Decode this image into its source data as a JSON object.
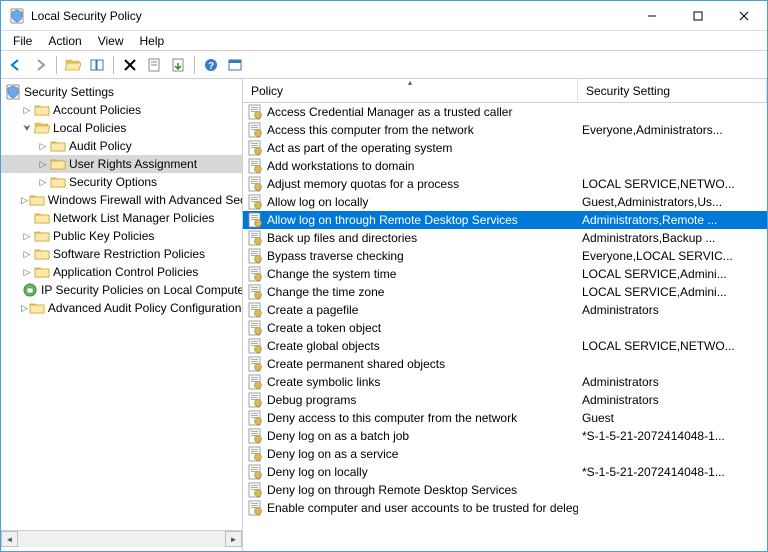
{
  "window": {
    "title": "Local Security Policy"
  },
  "menu": {
    "file": "File",
    "action": "Action",
    "view": "View",
    "help": "Help"
  },
  "tree": {
    "root": "Security Settings",
    "items": [
      {
        "label": "Account Policies",
        "expanded": false,
        "icon": "folder",
        "indent": 1
      },
      {
        "label": "Local Policies",
        "expanded": true,
        "icon": "folder",
        "indent": 1
      },
      {
        "label": "Audit Policy",
        "expanded": false,
        "icon": "folder",
        "indent": 2
      },
      {
        "label": "User Rights Assignment",
        "expanded": false,
        "icon": "folder",
        "indent": 2,
        "selected": true
      },
      {
        "label": "Security Options",
        "expanded": false,
        "icon": "folder",
        "indent": 2
      },
      {
        "label": "Windows Firewall with Advanced Sec",
        "expanded": false,
        "icon": "folder",
        "indent": 1
      },
      {
        "label": "Network List Manager Policies",
        "expanded": null,
        "icon": "folder",
        "indent": 1
      },
      {
        "label": "Public Key Policies",
        "expanded": false,
        "icon": "folder",
        "indent": 1
      },
      {
        "label": "Software Restriction Policies",
        "expanded": false,
        "icon": "folder",
        "indent": 1
      },
      {
        "label": "Application Control Policies",
        "expanded": false,
        "icon": "folder",
        "indent": 1
      },
      {
        "label": "IP Security Policies on Local Compute",
        "expanded": null,
        "icon": "ipsec",
        "indent": 1
      },
      {
        "label": "Advanced Audit Policy Configuration",
        "expanded": false,
        "icon": "folder",
        "indent": 1
      }
    ]
  },
  "list": {
    "columns": {
      "policy": "Policy",
      "setting": "Security Setting"
    },
    "rows": [
      {
        "policy": "Access Credential Manager as a trusted caller",
        "setting": ""
      },
      {
        "policy": "Access this computer from the network",
        "setting": "Everyone,Administrators..."
      },
      {
        "policy": "Act as part of the operating system",
        "setting": ""
      },
      {
        "policy": "Add workstations to domain",
        "setting": ""
      },
      {
        "policy": "Adjust memory quotas for a process",
        "setting": "LOCAL SERVICE,NETWO..."
      },
      {
        "policy": "Allow log on locally",
        "setting": "Guest,Administrators,Us..."
      },
      {
        "policy": "Allow log on through Remote Desktop Services",
        "setting": "Administrators,Remote ...",
        "selected": true
      },
      {
        "policy": "Back up files and directories",
        "setting": "Administrators,Backup ..."
      },
      {
        "policy": "Bypass traverse checking",
        "setting": "Everyone,LOCAL SERVIC..."
      },
      {
        "policy": "Change the system time",
        "setting": "LOCAL SERVICE,Admini..."
      },
      {
        "policy": "Change the time zone",
        "setting": "LOCAL SERVICE,Admini..."
      },
      {
        "policy": "Create a pagefile",
        "setting": "Administrators"
      },
      {
        "policy": "Create a token object",
        "setting": ""
      },
      {
        "policy": "Create global objects",
        "setting": "LOCAL SERVICE,NETWO..."
      },
      {
        "policy": "Create permanent shared objects",
        "setting": ""
      },
      {
        "policy": "Create symbolic links",
        "setting": "Administrators"
      },
      {
        "policy": "Debug programs",
        "setting": "Administrators"
      },
      {
        "policy": "Deny access to this computer from the network",
        "setting": "Guest"
      },
      {
        "policy": "Deny log on as a batch job",
        "setting": "*S-1-5-21-2072414048-1..."
      },
      {
        "policy": "Deny log on as a service",
        "setting": ""
      },
      {
        "policy": "Deny log on locally",
        "setting": "*S-1-5-21-2072414048-1..."
      },
      {
        "policy": "Deny log on through Remote Desktop Services",
        "setting": ""
      },
      {
        "policy": "Enable computer and user accounts to be trusted for delega",
        "setting": ""
      }
    ]
  }
}
